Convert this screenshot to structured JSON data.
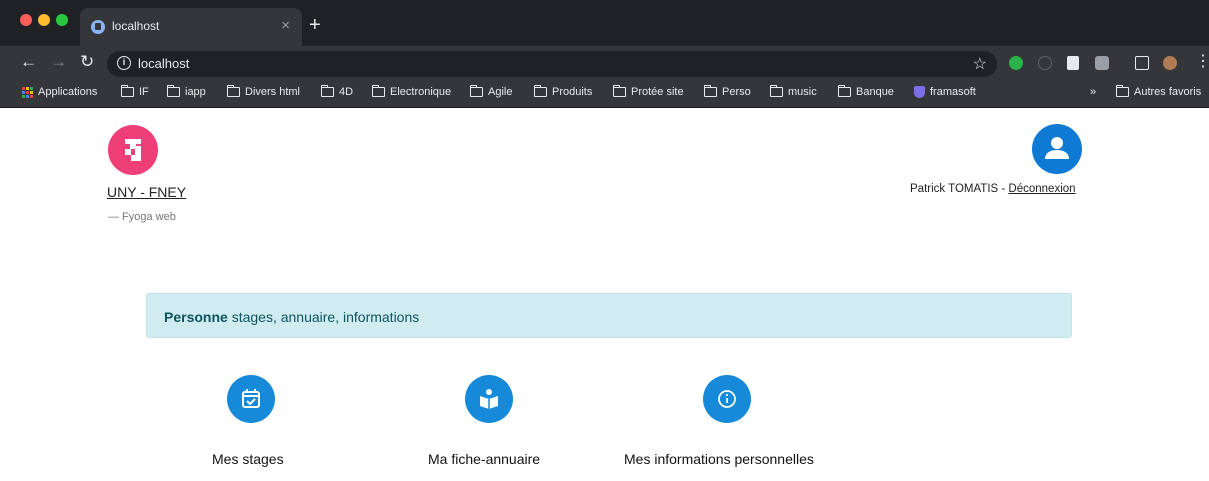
{
  "browser": {
    "tab_title": "localhost",
    "url": "localhost",
    "bookmarks": [
      {
        "label": "Applications",
        "icon": "apps-icon"
      },
      {
        "label": "IF",
        "icon": "folder-icon"
      },
      {
        "label": "iapp",
        "icon": "folder-icon"
      },
      {
        "label": "Divers html",
        "icon": "folder-icon"
      },
      {
        "label": "4D",
        "icon": "folder-icon"
      },
      {
        "label": "Electronique",
        "icon": "folder-icon"
      },
      {
        "label": "Agile",
        "icon": "folder-icon"
      },
      {
        "label": "Produits",
        "icon": "folder-icon"
      },
      {
        "label": "Protée site",
        "icon": "folder-icon"
      },
      {
        "label": "Perso",
        "icon": "folder-icon"
      },
      {
        "label": "music",
        "icon": "folder-icon"
      },
      {
        "label": "Banque",
        "icon": "folder-icon"
      },
      {
        "label": "framasoft",
        "icon": "shield-icon"
      }
    ],
    "overflow_label": "»",
    "other_bookmarks": "Autres favoris"
  },
  "header": {
    "site_title": "UNY - FNEY",
    "site_subtitle": "— Fyoga web",
    "user_name": "Patrick TOMATIS",
    "separator": " - ",
    "logout_label": "Déconnexion"
  },
  "alert": {
    "strong": "Personne",
    "text": " stages, annuaire, informations"
  },
  "tiles": [
    {
      "label": "Mes stages",
      "icon": "calendar-check-icon"
    },
    {
      "label": "Ma fiche-annuaire",
      "icon": "book-person-icon"
    },
    {
      "label": "Mes informations personnelles",
      "icon": "info-icon"
    }
  ],
  "colors": {
    "logo": "#ef3f78",
    "avatar": "#0f7ad4",
    "tile_icon": "#1689d8",
    "alert_bg": "#d1ecf1",
    "alert_text": "#0c5460"
  }
}
